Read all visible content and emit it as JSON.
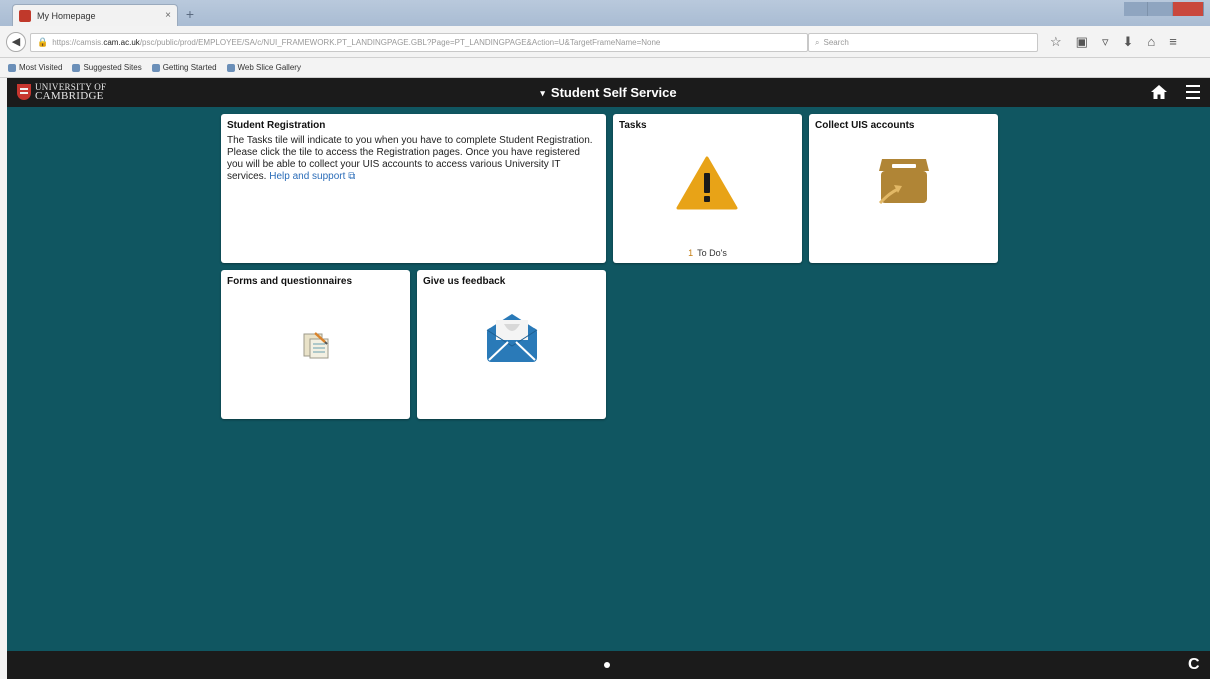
{
  "browser": {
    "tab_title": "My Homepage",
    "tab_close": "×",
    "new_tab": "+",
    "url_prefix": "https://camsis.",
    "url_host": "cam.ac.uk",
    "url_rest": "/psc/public/prod/EMPLOYEE/SA/c/NUI_FRAMEWORK.PT_LANDINGPAGE.GBL?Page=PT_LANDINGPAGE&Action=U&TargetFrameName=None",
    "search_placeholder": "Search",
    "bookmarks": [
      "Most Visited",
      "Suggested Sites",
      "Getting Started",
      "Web Slice Gallery"
    ]
  },
  "header": {
    "logo_line1": "UNIVERSITY OF",
    "logo_line2": "CAMBRIDGE",
    "caret": "▾",
    "title": "Student Self Service"
  },
  "tiles": {
    "registration": {
      "title": "Student Registration",
      "body": "The Tasks tile will indicate to you when you have to complete Student Registration. Please click the tile to access the Registration pages. Once you have registered you will be able to collect your UIS accounts to access various University IT services.",
      "link": "Help and support"
    },
    "tasks": {
      "title": "Tasks",
      "count": "1",
      "count_label": "To Do's"
    },
    "collect": {
      "title": "Collect UIS accounts"
    },
    "forms": {
      "title": "Forms and questionnaires"
    },
    "feedback": {
      "title": "Give us feedback"
    }
  },
  "footer": {
    "refresh": "C"
  },
  "colors": {
    "header_bg": "#1b1b1b",
    "main_bg": "#105661",
    "warning": "#e8a317",
    "box": "#b08536",
    "envelope": "#2a7ab8"
  }
}
